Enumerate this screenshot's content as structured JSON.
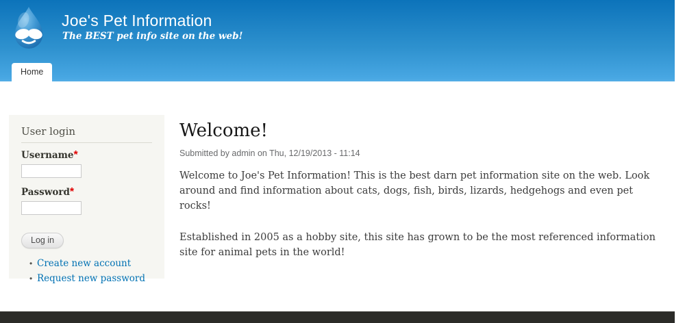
{
  "header": {
    "site_name": "Joe's Pet Information",
    "tagline": "The BEST pet info site on the web!",
    "logo_icon": "druplicon-drupal-logo"
  },
  "nav": {
    "tabs": [
      {
        "label": "Home",
        "active": true
      }
    ]
  },
  "sidebar": {
    "user_login": {
      "title": "User login",
      "username": {
        "label": "Username",
        "required": "*",
        "value": ""
      },
      "password": {
        "label": "Password",
        "required": "*",
        "value": ""
      },
      "submit_label": "Log in",
      "links": [
        {
          "label": "Create new account"
        },
        {
          "label": "Request new password"
        }
      ]
    }
  },
  "main": {
    "title": "Welcome!",
    "submitted": "Submitted by admin on Thu, 12/19/2013 - 11:14",
    "paragraphs": [
      "Welcome to Joe's Pet Information! This is the best darn pet information site on the web. Look around and find information about cats, dogs, fish, birds, lizards, hedgehogs and even pet rocks!",
      "Established in 2005 as a hobby site, this site has grown to be the most referenced information site for animal pets in the world!"
    ]
  },
  "colors": {
    "header_gradient_top": "#0c73ba",
    "header_gradient_bottom": "#48a7e3",
    "sidebar_background": "#f6f6f2",
    "link_blue": "#0071b3",
    "required_red": "#e00000",
    "footer_background": "#2b2b28",
    "body_text": "#3b3b3b"
  }
}
